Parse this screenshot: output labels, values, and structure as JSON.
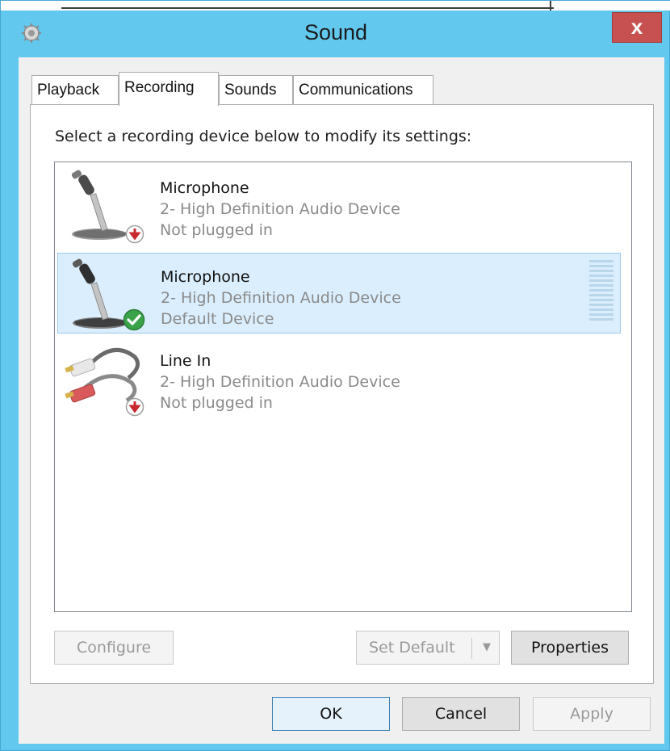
{
  "window": {
    "title": "Sound",
    "close_label": "x",
    "colors": {
      "frame": "#62c8ee",
      "close": "#c75050",
      "selection": "#dbeefd"
    }
  },
  "tabs": [
    {
      "label": "Playback",
      "active": false
    },
    {
      "label": "Recording",
      "active": true
    },
    {
      "label": "Sounds",
      "active": false
    },
    {
      "label": "Communications",
      "active": false
    }
  ],
  "instruction": "Select a recording device below to modify its settings:",
  "devices": [
    {
      "name": "Microphone",
      "description": "2- High Definition Audio Device",
      "status": "Not plugged in",
      "icon": "microphone-icon",
      "badge": "unplugged-badge-icon",
      "selected": false
    },
    {
      "name": "Microphone",
      "description": "2- High Definition Audio Device",
      "status": "Default Device",
      "icon": "microphone-icon",
      "badge": "default-check-badge-icon",
      "selected": true
    },
    {
      "name": "Line In",
      "description": "2- High Definition Audio Device",
      "status": "Not plugged in",
      "icon": "line-in-cable-icon",
      "badge": "unplugged-badge-icon",
      "selected": false
    }
  ],
  "buttons": {
    "configure": "Configure",
    "set_default": "Set Default",
    "properties": "Properties",
    "ok": "OK",
    "cancel": "Cancel",
    "apply": "Apply"
  }
}
